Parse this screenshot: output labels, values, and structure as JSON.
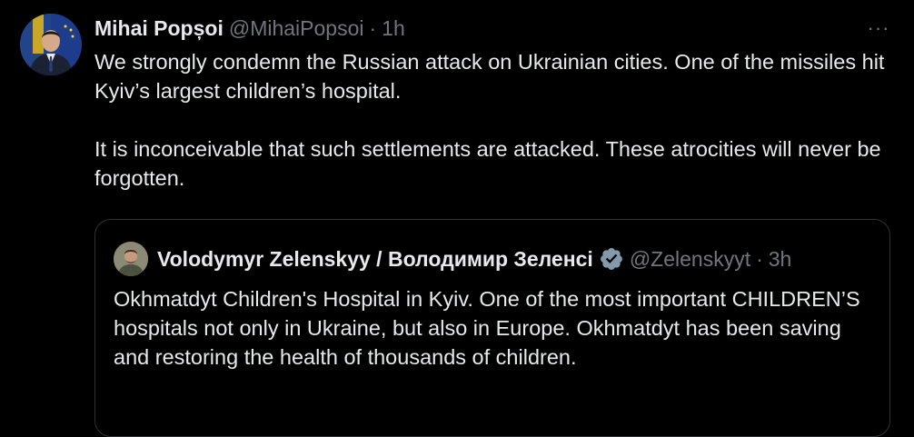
{
  "tweet": {
    "author_name": "Mihai Popșoi",
    "author_handle": "@MihaiPopsoi",
    "separator": "·",
    "time": "1h",
    "more_label": "···",
    "paragraphs": [
      "We strongly condemn the Russian attack on Ukrainian cities. One of the missiles hit Kyiv’s largest children’s hospital.",
      "It is inconceivable that such settlements are attacked. These atrocities will never be forgotten."
    ],
    "avatar_icon": "profile-photo-icon"
  },
  "quoted_tweet": {
    "author_name": "Volodymyr Zelenskyy / Володимир Зеленсі",
    "author_handle": "@Zelenskyyt",
    "verified_icon": "verified-badge-icon",
    "verified_color": "#1d9bf0",
    "separator": "·",
    "time": "3h",
    "text": "Okhmatdyt Children's Hospital in Kyiv. One of the most important CHILDREN’S hospitals not only in Ukraine, but also in Europe. Okhmatdyt has been saving and restoring the health of thousands of children."
  },
  "colors": {
    "background": "#000000",
    "text_primary": "#e7e9ea",
    "text_secondary": "#71767b",
    "border": "#2f3336"
  }
}
